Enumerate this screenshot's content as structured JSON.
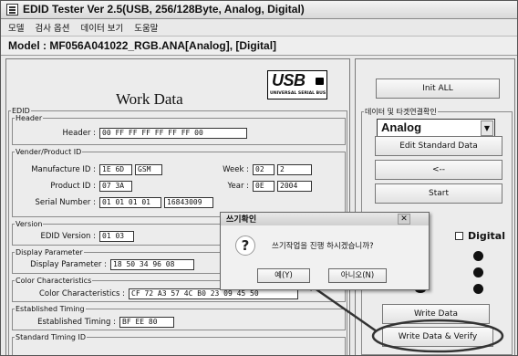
{
  "window": {
    "title": "EDID Tester Ver 2.5(USB, 256/128Byte, Analog, Digital)",
    "icon": "app-icon"
  },
  "menu": [
    "모델",
    "검사 옵션",
    "데이터 보기",
    "도움말"
  ],
  "model_line": "Model : MF056A041022_RGB.ANA[Analog], [Digital]",
  "work_data": {
    "title": "Work Data",
    "usb_logo": {
      "main": "USB",
      "sub": "UNIVERSAL SERIAL BUS"
    },
    "edid": {
      "legend": "EDID",
      "header_group": "Header",
      "header_label": "Header :",
      "header_value": "00 FF FF FF FF FF FF 00",
      "vendor_group": "Vender/Product ID",
      "manufacture_label": "Manufacture ID :",
      "manufacture_hex": "1E 6D",
      "manufacture_name": "GSM",
      "week_label": "Week :",
      "week_hex": "02",
      "week_dec": "2",
      "product_label": "Product ID :",
      "product_value": "07 3A",
      "year_label": "Year :",
      "year_hex": "0E",
      "year_dec": "2004",
      "serial_label": "Serial Number :",
      "serial_hex": "01 01 01 01",
      "serial_dec": "16843009",
      "version_group": "Version",
      "version_label": "EDID Version :",
      "version_value": "01 03",
      "display_group": "Display Parameter",
      "display_label": "Display Parameter :",
      "display_value": "18 50 34 96 08",
      "color_group": "Color Characteristics",
      "color_label": "Color Characteristics :",
      "color_value": "CF 72 A3 57 4C B0 23 09 45 50",
      "established_group": "Established Timing",
      "established_label": "Established Timing :",
      "established_value": "BF EE 80",
      "standard_group": "Standard Timing ID"
    }
  },
  "right_panel": {
    "init_all": "Init ALL",
    "data_section_label": "데이터 및 타겟연결확인",
    "mode_select": "Analog",
    "edit_standard": "Edit Standard Data",
    "arrow_button": "<--",
    "start_button": "Start",
    "digital_label": "Digital",
    "write_data": "Write Data",
    "write_verify": "Write Data & Verify"
  },
  "dialog": {
    "title": "쓰기확인",
    "message": "쓰기작업을 진행 하시겠습니까?",
    "yes": "예(Y)",
    "no": "아니오(N)",
    "icon": "question-icon"
  },
  "colors": {
    "window_bg": "#e9e9e9",
    "annotation": "#333333"
  }
}
